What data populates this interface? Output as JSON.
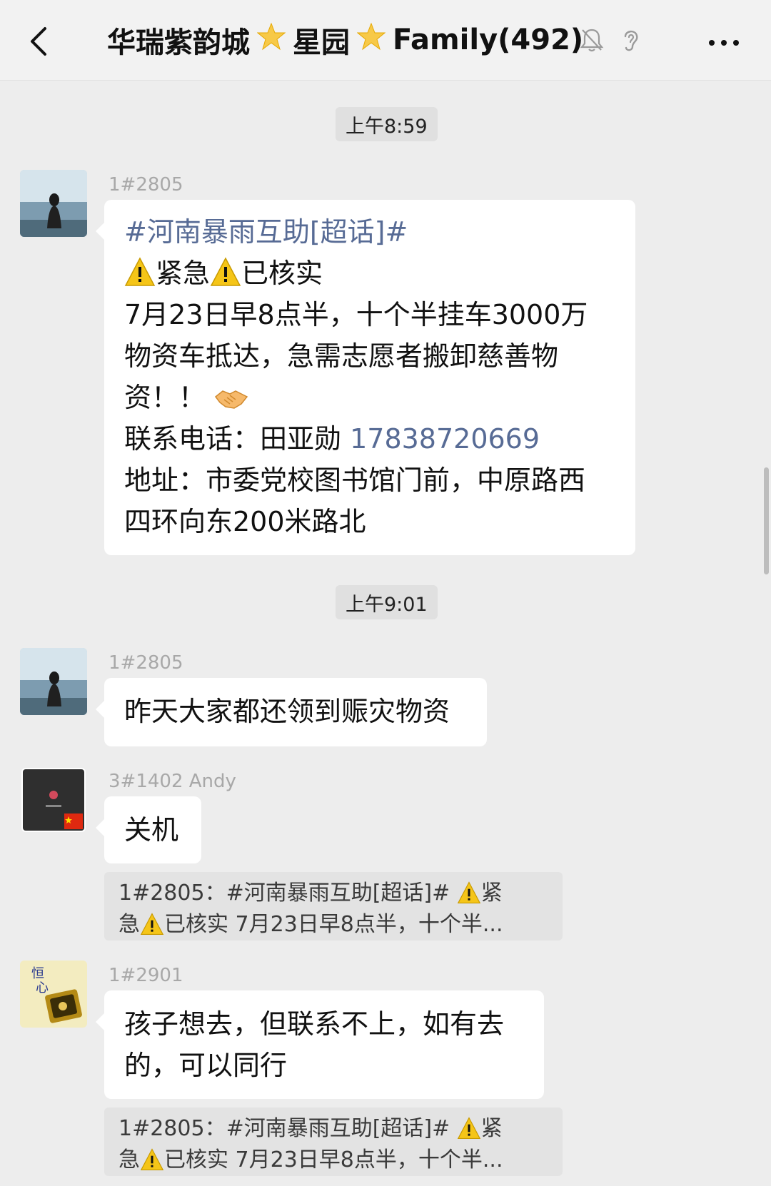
{
  "header": {
    "title_part1": "华瑞紫韵城",
    "title_part2": "星园",
    "title_part3": "Family(492)",
    "star_icon": "star-icon",
    "mute_icon": "bell-slash-icon",
    "ear_icon": "ear-icon",
    "back_icon": "chevron-left-icon",
    "more_icon": "more-dots-icon"
  },
  "messages": {
    "t1": "上午8:59",
    "m1": {
      "sender": "1#2805",
      "hashtag": "#河南暴雨互助[超话]#",
      "warn1": "紧急",
      "warn2": "已核实",
      "line3": "7月23日早8点半，十个半挂车3000万",
      "line4": "物资车抵达，急需志愿者搬卸慈善物",
      "line5": "资！！",
      "contact_label": "联系电话：田亚勋 ",
      "phone": "17838720669",
      "line7": "地址：市委党校图书馆门前，中原路西",
      "line8": "四环向东200米路北"
    },
    "t2": "上午9:01",
    "m2": {
      "sender": "1#2805",
      "text": "昨天大家都还领到赈灾物资"
    },
    "m3": {
      "sender": "3#1402 Andy",
      "text": "关机",
      "quote_line1a": "1#2805：#河南暴雨互助[超话]# ",
      "quote_line1b": "紧",
      "quote_line2a": "急",
      "quote_line2b": "已核实 7月23日早8点半，十个半..."
    },
    "m4": {
      "sender": "1#2901",
      "line1": "孩子想去，但联系不上，如有去",
      "line2": "的，可以同行",
      "quote_line1a": "1#2805：#河南暴雨互助[超话]# ",
      "quote_line1b": "紧",
      "quote_line2a": "急",
      "quote_line2b": "已核实 7月23日早8点半，十个半..."
    }
  },
  "colors": {
    "link": "#576b95",
    "background": "#ededed",
    "bubble": "#ffffff"
  }
}
